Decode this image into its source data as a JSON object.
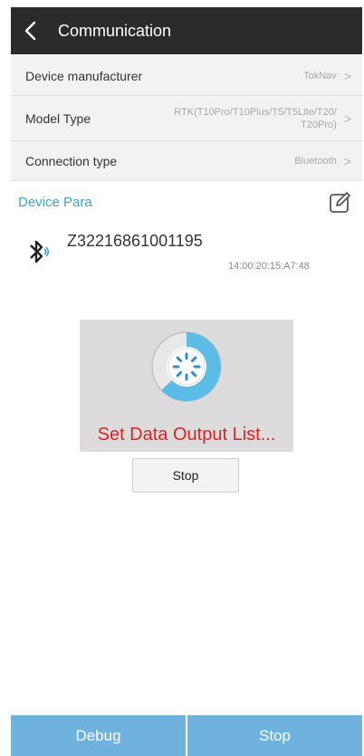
{
  "header": {
    "title": "Communication",
    "back_icon": "chevron-left-icon"
  },
  "settings": [
    {
      "label": "Device manufacturer",
      "value": "TokNav"
    },
    {
      "label": "Model Type",
      "value_line1": "RTK(T10Pro/T10Plus/T5/T5Lite/T20/",
      "value_line2": "T20Pro)"
    },
    {
      "label": "Connection type",
      "value": "Bluetooth"
    }
  ],
  "device_para": {
    "title": "Device Para",
    "edit_icon": "edit-icon"
  },
  "device": {
    "name": "Z32216861001195",
    "mac": "14:00:20:15:A7:48",
    "icon": "bluetooth-icon"
  },
  "progress": {
    "message": "Set Data Output List...",
    "stop_label": "Stop"
  },
  "bottom": {
    "debug_label": "Debug",
    "stop_label": "Stop"
  },
  "colors": {
    "header_bg": "#2b2b2b",
    "accent": "#3aa0db",
    "error": "#e02020",
    "button_bg": "#6eb2dd"
  }
}
